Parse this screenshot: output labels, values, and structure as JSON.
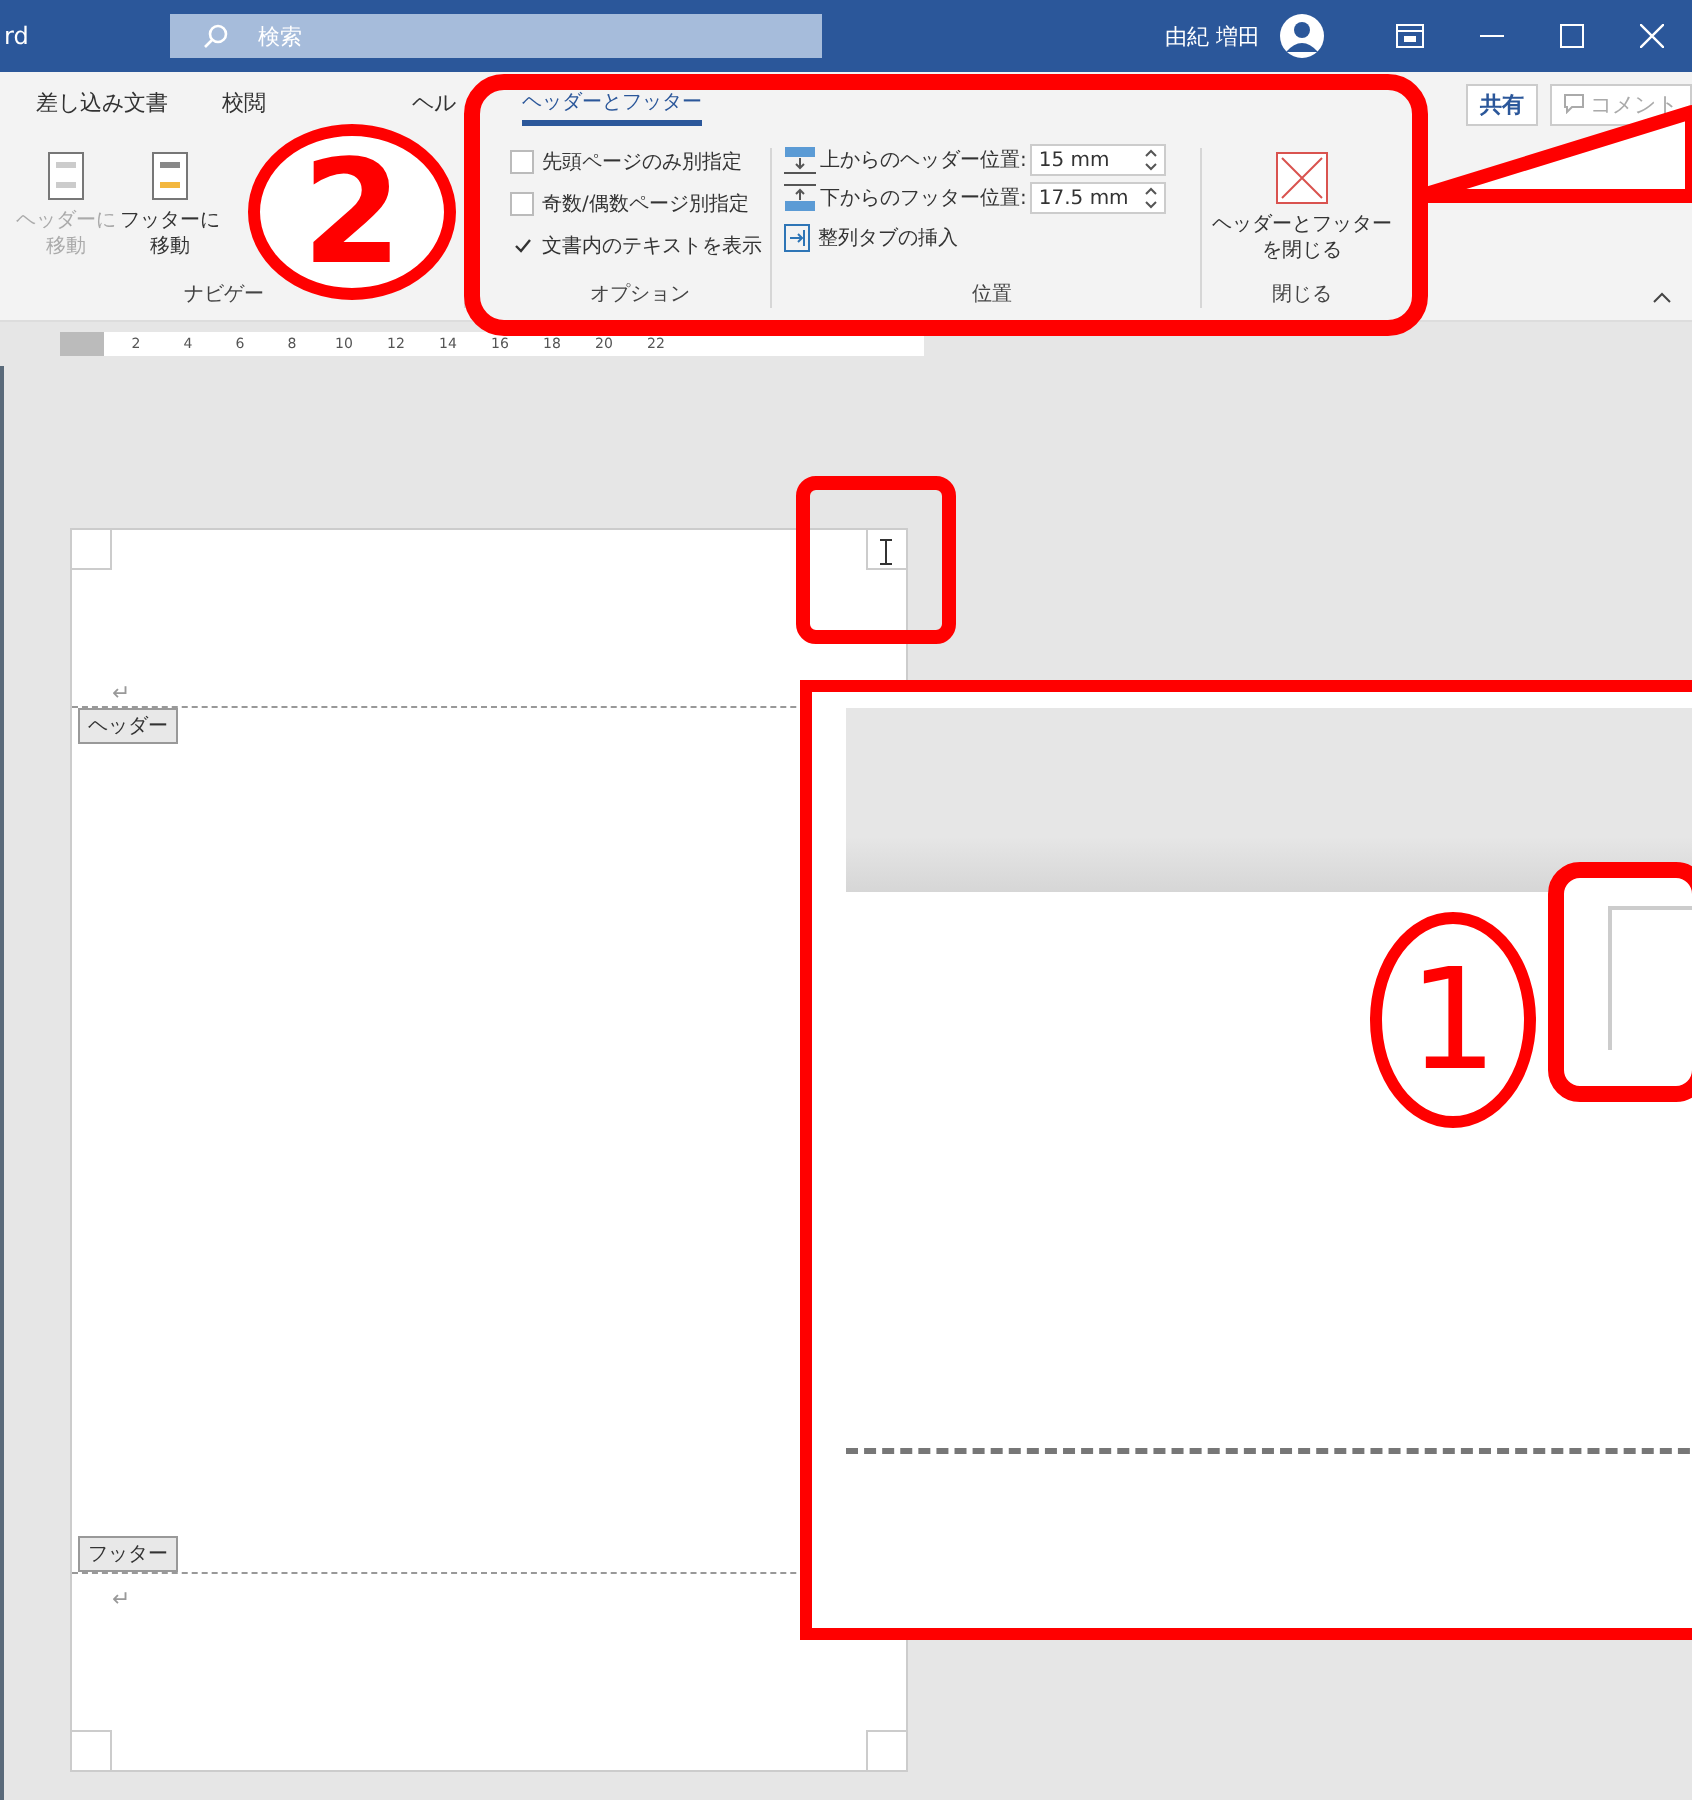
{
  "window": {
    "title_fragment": "rd",
    "search_placeholder": "検索",
    "user": "由紀 増田"
  },
  "tabs": [
    {
      "label": "差し込み文書",
      "selected": false
    },
    {
      "label": "校閲",
      "selected": false
    },
    {
      "label": "ヘル",
      "selected": false
    },
    {
      "label": "ヘッダーとフッター",
      "selected": true
    }
  ],
  "share_button": "共有",
  "comment_button": {
    "label": "コメント",
    "disabled": true
  },
  "ribbon": {
    "groups": [
      {
        "kind": "navigation",
        "label": "ナビゲー",
        "buttons": [
          {
            "lines": [
              "ヘッダーに",
              "移動"
            ],
            "disabled": true
          },
          {
            "lines": [
              "フッターに",
              "移動"
            ],
            "disabled": false
          }
        ]
      },
      {
        "kind": "options",
        "label": "オプション",
        "checkboxes": [
          {
            "label": "先頭ページのみ別指定",
            "checked": false
          },
          {
            "label": "奇数/偶数ページ別指定",
            "checked": false
          },
          {
            "label": "文書内のテキストを表示",
            "checked": true
          }
        ]
      },
      {
        "kind": "position",
        "label": "位置",
        "spinners": [
          {
            "label": "上からのヘッダー位置:",
            "value": "15 mm"
          },
          {
            "label": "下からのフッター位置:",
            "value": "17.5 mm"
          }
        ],
        "insert_tab": "整列タブの挿入"
      },
      {
        "kind": "close",
        "label": "閉じる",
        "button_lines": [
          "ヘッダーとフッター",
          "を閉じる"
        ]
      }
    ]
  },
  "ruler": {
    "numbers": [
      "2",
      "4",
      "6",
      "8",
      "10",
      "12",
      "14",
      "16",
      "18",
      "20",
      "22"
    ]
  },
  "document": {
    "header_mark": "↵",
    "header_tag": "ヘッダー",
    "footer_tag": "フッター",
    "footer_mark": "↵"
  },
  "annotations": [
    {
      "kind": "circle_number",
      "label": "2"
    },
    {
      "kind": "circle_number",
      "label": "1"
    }
  ]
}
